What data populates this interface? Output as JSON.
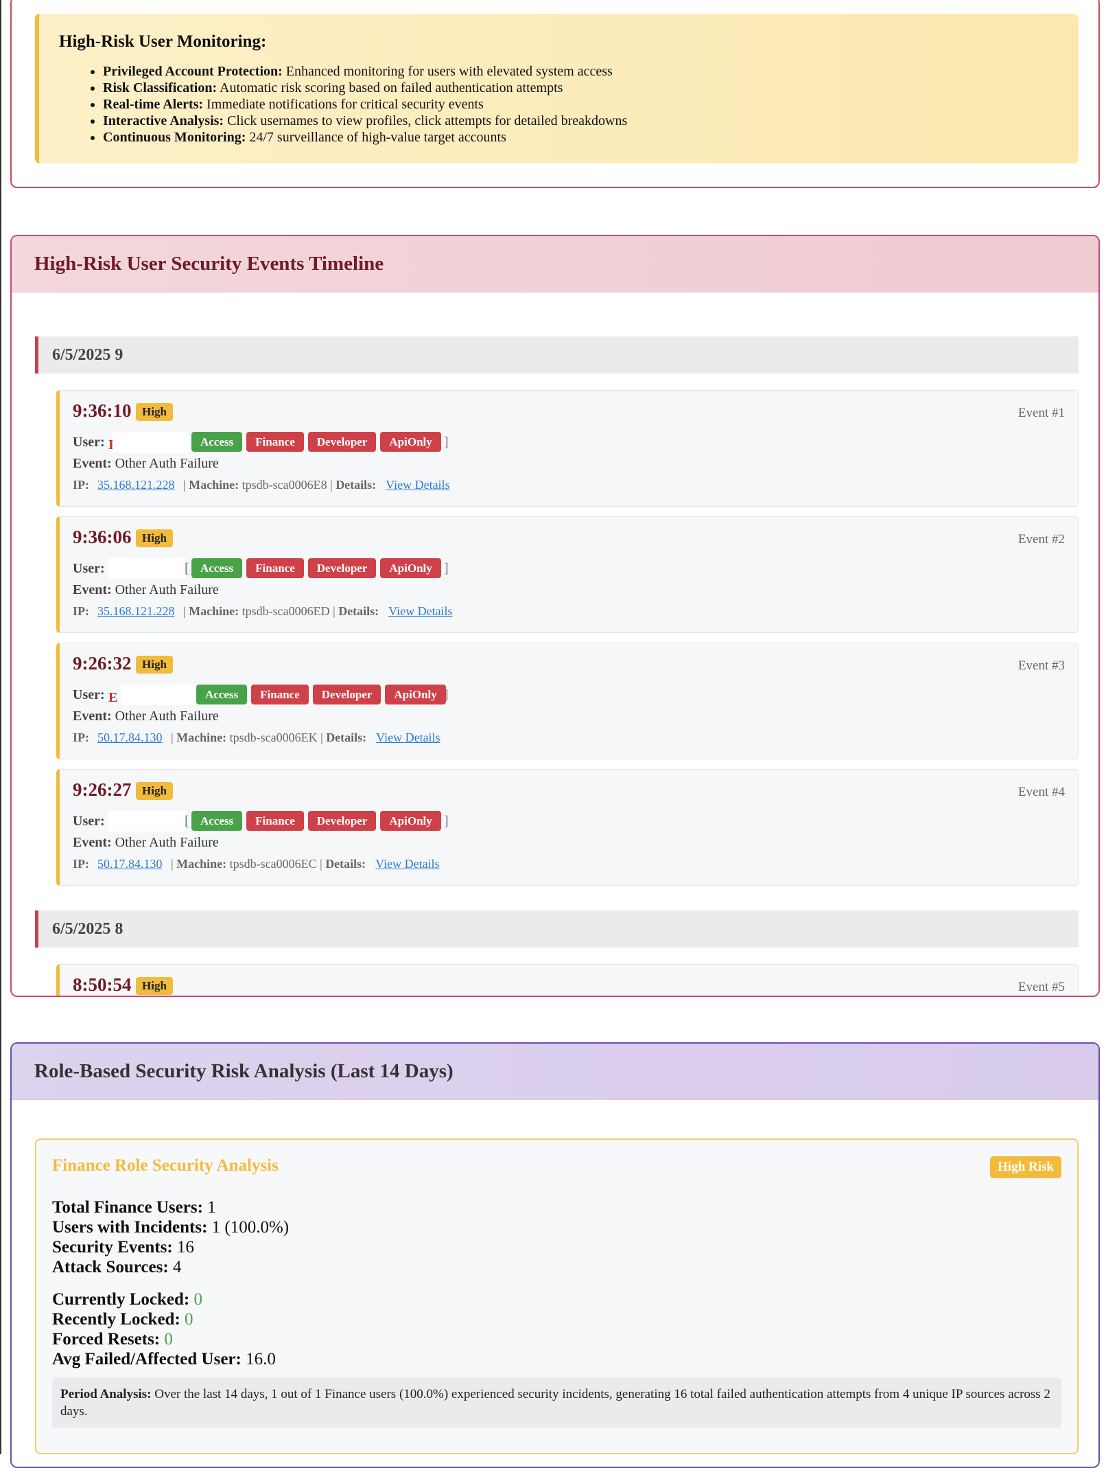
{
  "monitoring": {
    "title": "High-Risk User Monitoring:",
    "items": [
      {
        "label": "Privileged Account Protection:",
        "text": " Enhanced monitoring for users with elevated system access"
      },
      {
        "label": "Risk Classification:",
        "text": " Automatic risk scoring based on failed authentication attempts"
      },
      {
        "label": "Real-time Alerts:",
        "text": " Immediate notifications for critical security events"
      },
      {
        "label": "Interactive Analysis:",
        "text": " Click usernames to view profiles, click attempts for detailed breakdowns"
      },
      {
        "label": "Continuous Monitoring:",
        "text": " 24/7 surveillance of high-value target accounts"
      }
    ]
  },
  "timeline": {
    "title": "High-Risk User Security Events Timeline",
    "groups": [
      {
        "date": "6/5/2025 9",
        "events": [
          {
            "time": "9:36:10",
            "severity": "High",
            "number": "Event #1",
            "event_type": "Other Auth Failure",
            "ip": "35.168.121.228",
            "machine": "tpsdb-sca0006E8",
            "details_link": "View Details"
          },
          {
            "time": "9:36:06",
            "severity": "High",
            "number": "Event #2",
            "event_type": "Other Auth Failure",
            "ip": "35.168.121.228",
            "machine": "tpsdb-sca0006ED",
            "details_link": "View Details"
          },
          {
            "time": "9:26:32",
            "severity": "High",
            "number": "Event #3",
            "event_type": "Other Auth Failure",
            "ip": "50.17.84.130",
            "machine": "tpsdb-sca0006EK",
            "details_link": "View Details"
          },
          {
            "time": "9:26:27",
            "severity": "High",
            "number": "Event #4",
            "event_type": "Other Auth Failure",
            "ip": "50.17.84.130",
            "machine": "tpsdb-sca0006EC",
            "details_link": "View Details"
          }
        ]
      },
      {
        "date": "6/5/2025 8",
        "events": [
          {
            "time": "8:50:54",
            "severity": "High",
            "number": "Event #5"
          }
        ]
      }
    ],
    "labels": {
      "user": "User:",
      "event": "Event:",
      "ip": "IP:",
      "machine": "Machine:",
      "details": "Details:"
    },
    "role_tags": [
      "Access",
      "Finance",
      "Developer",
      "ApiOnly"
    ]
  },
  "roles": {
    "title": "Role-Based Security Risk Analysis (Last 14 Days)",
    "finance": {
      "title": "Finance Role Security Analysis",
      "risk_badge": "High Risk",
      "stats1": [
        {
          "label": "Total Finance Users:",
          "value": "1"
        },
        {
          "label": "Users with Incidents:",
          "value": "1 (100.0%)"
        },
        {
          "label": "Security Events:",
          "value": "16"
        },
        {
          "label": "Attack Sources:",
          "value": "4"
        }
      ],
      "stats2": [
        {
          "label": "Currently Locked:",
          "value": "0"
        },
        {
          "label": "Recently Locked:",
          "value": "0"
        },
        {
          "label": "Forced Resets:",
          "value": "0"
        },
        {
          "label": "Avg Failed/Affected User:",
          "value": "16.0"
        }
      ],
      "period_label": "Period Analysis:",
      "period_text": " Over the last 14 days, 1 out of 1 Finance users (100.0%) experienced security incidents, generating 16 total failed authentication attempts from 4 unique IP sources across 2 days."
    }
  },
  "colors": {
    "accent_red": "#c94050",
    "badge_yellow": "#f2bb3b",
    "tag_green": "#4aa248",
    "tag_red": "#cf4149",
    "link_blue": "#2a7ad6",
    "purple_border": "#6a4fb2"
  }
}
